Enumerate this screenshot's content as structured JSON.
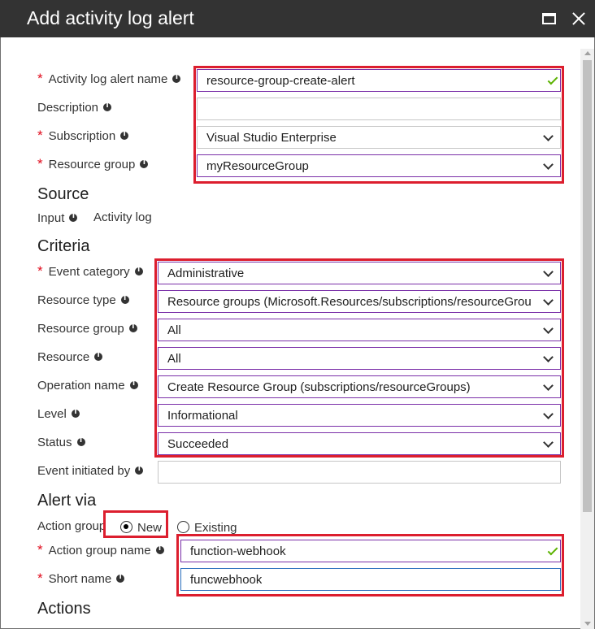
{
  "window": {
    "title": "Add activity log alert"
  },
  "alert": {
    "name_label": "Activity log alert name",
    "name_value": "resource-group-create-alert",
    "description_label": "Description",
    "description_value": "",
    "subscription_label": "Subscription",
    "subscription_value": "Visual Studio Enterprise",
    "resource_group_label": "Resource group",
    "resource_group_value": "myResourceGroup"
  },
  "source": {
    "heading": "Source",
    "input_label": "Input",
    "input_value": "Activity log"
  },
  "criteria": {
    "heading": "Criteria",
    "event_category_label": "Event category",
    "event_category_value": "Administrative",
    "resource_type_label": "Resource type",
    "resource_type_value": "Resource groups (Microsoft.Resources/subscriptions/resourceGroups)",
    "resource_group_label": "Resource group",
    "resource_group_value": "All",
    "resource_label": "Resource",
    "resource_value": "All",
    "operation_label": "Operation name",
    "operation_value": "Create Resource Group (subscriptions/resourceGroups)",
    "level_label": "Level",
    "level_value": "Informational",
    "status_label": "Status",
    "status_value": "Succeeded",
    "initiated_label": "Event initiated by",
    "initiated_value": ""
  },
  "alert_via": {
    "heading": "Alert via",
    "action_group_label": "Action group",
    "option_new": "New",
    "option_existing": "Existing",
    "selected": "New",
    "action_group_name_label": "Action group name",
    "action_group_name_value": "function-webhook",
    "short_name_label": "Short name",
    "short_name_value": "funcwebhook"
  },
  "actions": {
    "heading": "Actions"
  },
  "colors": {
    "highlight": "#dc1e2e",
    "titlebar": "#333333",
    "required": "#e00b1c",
    "valid_check": "#5bb200"
  }
}
